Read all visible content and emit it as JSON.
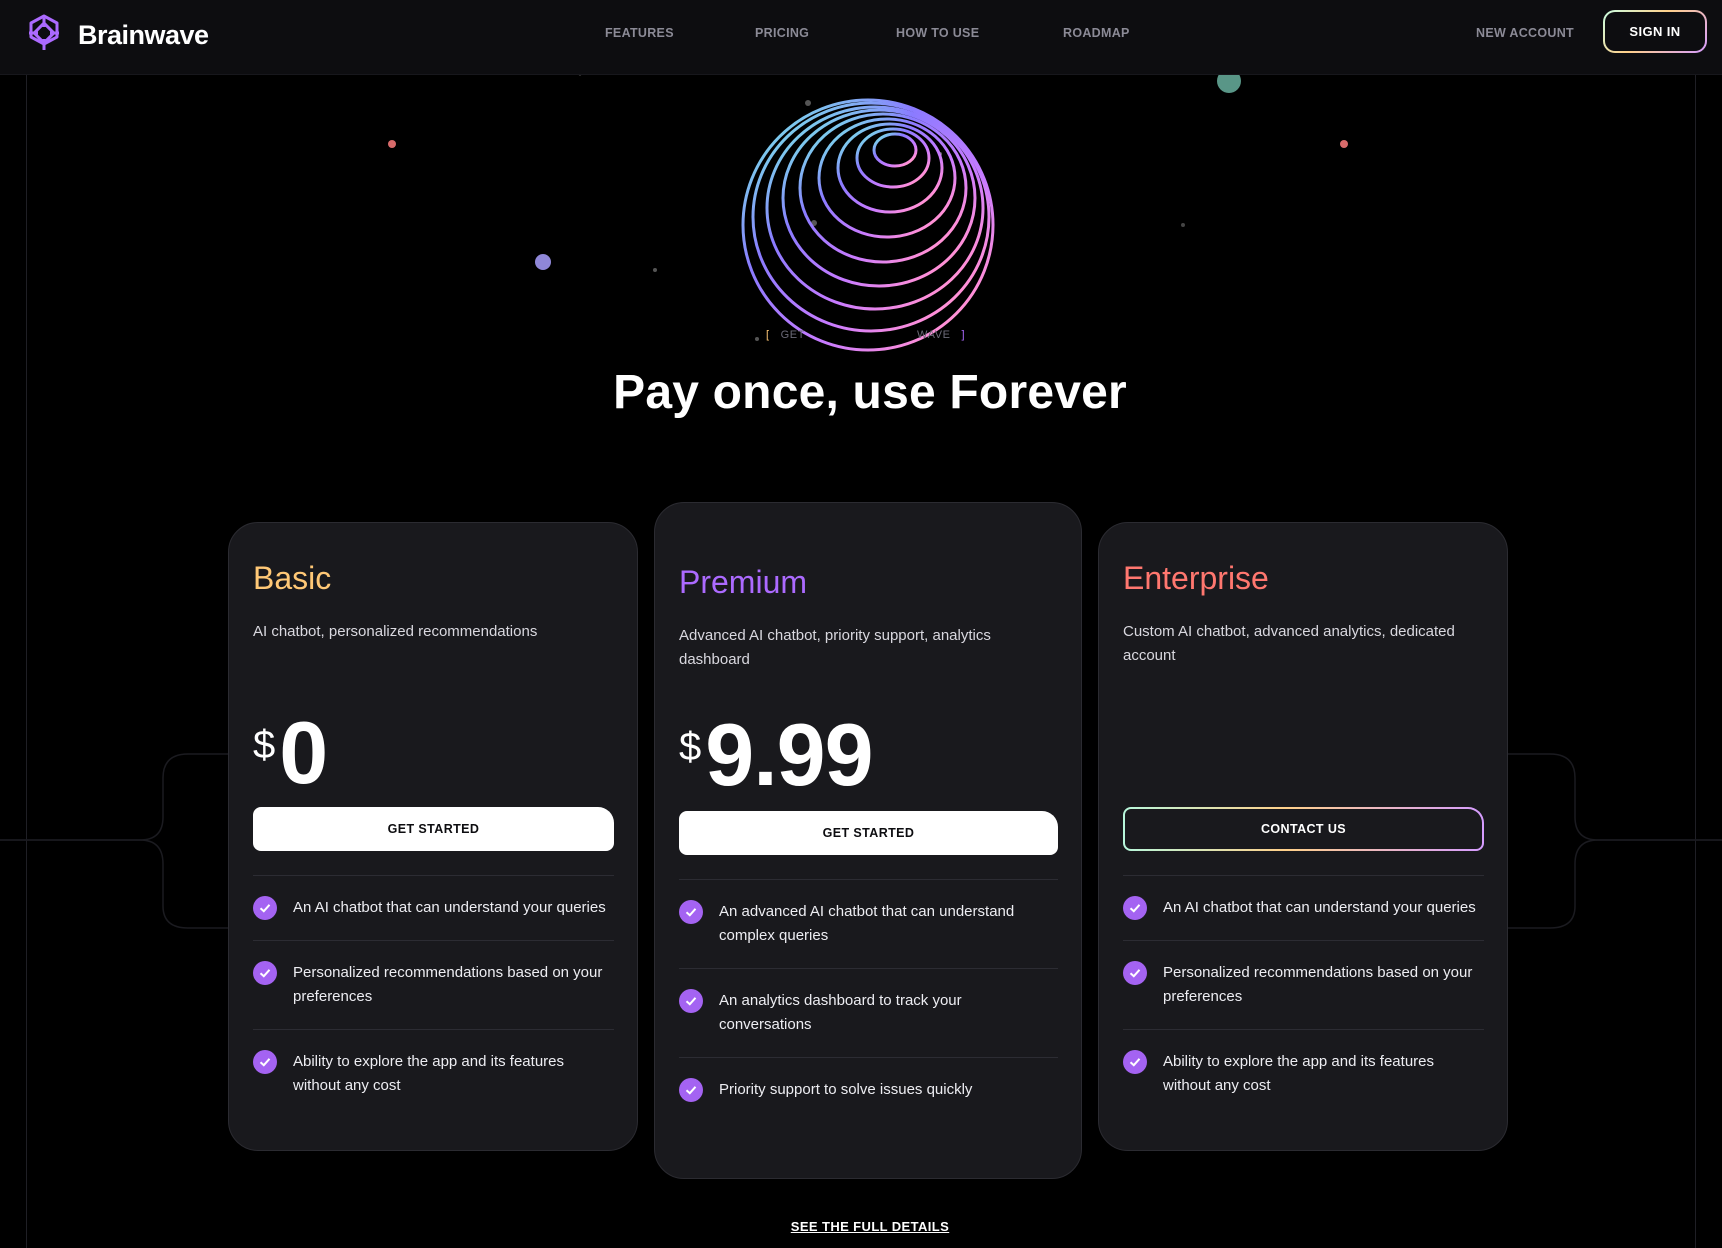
{
  "nav": {
    "brand": "Brainwave",
    "links": [
      "FEATURES",
      "PRICING",
      "HOW TO USE",
      "ROADMAP"
    ],
    "new_account": "NEW ACCOUNT",
    "sign_in": "SIGN IN"
  },
  "hero": {
    "orb_caption_left": "GET",
    "orb_caption_right": "WAVE",
    "title": "Pay once, use Forever"
  },
  "plans": [
    {
      "name": "Basic",
      "color": "#ffc876",
      "description": "AI chatbot, personalized recommendations",
      "currency": "$",
      "price": "0",
      "button": "GET STARTED",
      "features": [
        "An AI chatbot that can understand your queries",
        "Personalized recommendations based on your preferences",
        "Ability to explore the app and its features without any cost"
      ]
    },
    {
      "name": "Premium",
      "color": "#ac6aff",
      "description": "Advanced AI chatbot, priority support, analytics dashboard",
      "currency": "$",
      "price": "9.99",
      "button": "GET STARTED",
      "features": [
        "An advanced AI chatbot that can understand complex queries",
        "An analytics dashboard to track your conversations",
        "Priority support to solve issues quickly"
      ]
    },
    {
      "name": "Enterprise",
      "color": "#ff776f",
      "description": "Custom AI chatbot, advanced analytics, dedicated account",
      "button": "CONTACT US",
      "features": [
        "An AI chatbot that can understand your queries",
        "Personalized recommendations based on your preferences",
        "Ability to explore the app and its features without any cost"
      ]
    }
  ],
  "footer_link": "SEE THE FULL DETAILS",
  "icons": {
    "logo": "brainwave-logo-icon",
    "feature_check": "check-circle-icon"
  },
  "colors": {
    "background": "#000000",
    "card_background": "#19191d",
    "check_accent": "#a463f2"
  }
}
